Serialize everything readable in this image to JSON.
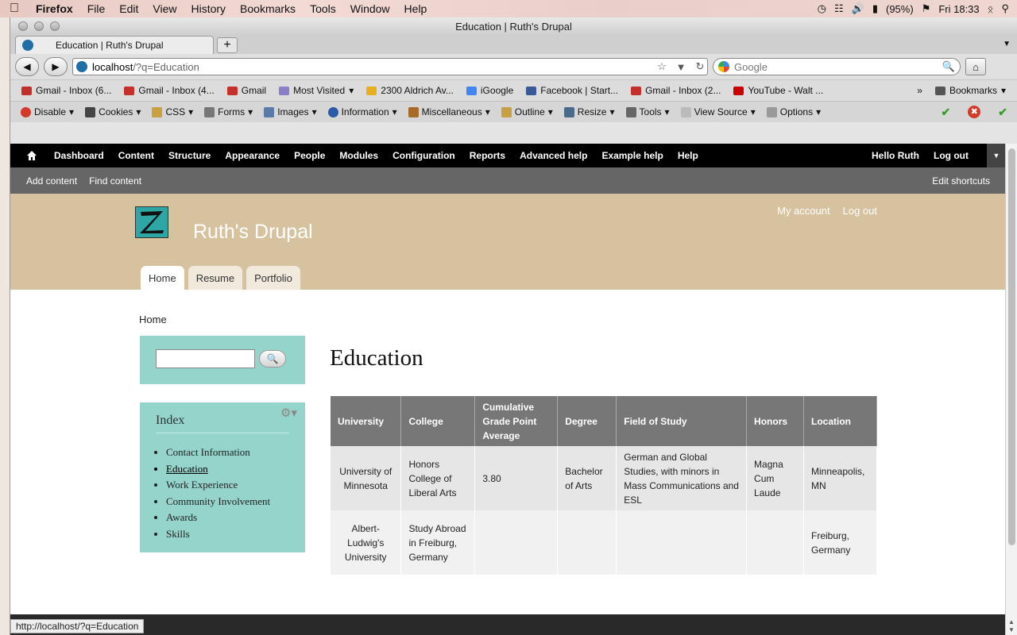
{
  "macbar": {
    "app": "Firefox",
    "menus": [
      "File",
      "Edit",
      "View",
      "History",
      "Bookmarks",
      "Tools",
      "Window",
      "Help"
    ],
    "battery": "(95%)",
    "clock": "Fri 18:33"
  },
  "window": {
    "title": "Education | Ruth's Drupal"
  },
  "tabs": [
    {
      "label": "Education | Ruth's Drupal"
    }
  ],
  "url": {
    "host": "localhost",
    "path": "/?q=Education"
  },
  "search": {
    "placeholder": "Google"
  },
  "bookmarks": {
    "items": [
      {
        "label": "Gmail - Inbox (6...",
        "color": "#c4302b"
      },
      {
        "label": "Gmail - Inbox (4...",
        "color": "#c4302b"
      },
      {
        "label": "Gmail",
        "color": "#c4302b"
      },
      {
        "label": "Most Visited",
        "color": "#8b7fc9"
      },
      {
        "label": "2300 Aldrich Av...",
        "color": "#e8b020"
      },
      {
        "label": "iGoogle",
        "color": "#4285f4"
      },
      {
        "label": "Facebook | Start...",
        "color": "#3b5998"
      },
      {
        "label": "Gmail - Inbox (2...",
        "color": "#c4302b"
      },
      {
        "label": "YouTube - Walt ...",
        "color": "#cc0000"
      }
    ],
    "overflow": "»",
    "bookmarks_label": "Bookmarks"
  },
  "devbar": {
    "items": [
      "Disable",
      "Cookies",
      "CSS",
      "Forms",
      "Images",
      "Information",
      "Miscellaneous",
      "Outline",
      "Resize",
      "Tools",
      "View Source",
      "Options"
    ]
  },
  "admin": {
    "items": [
      "Dashboard",
      "Content",
      "Structure",
      "Appearance",
      "People",
      "Modules",
      "Configuration",
      "Reports",
      "Advanced help",
      "Example help",
      "Help"
    ],
    "hello": "Hello Ruth",
    "logout": "Log out"
  },
  "shortcuts": {
    "items": [
      "Add content",
      "Find content"
    ],
    "edit": "Edit shortcuts"
  },
  "site": {
    "name": "Ruth's Drupal",
    "secondary": [
      "My account",
      "Log out"
    ],
    "tabs": [
      "Home",
      "Resume",
      "Portfolio"
    ]
  },
  "breadcrumb": "Home",
  "index": {
    "title": "Index",
    "items": [
      "Contact Information",
      "Education",
      "Work Experience",
      "Community Involvement",
      "Awards",
      "Skills"
    ]
  },
  "page": {
    "title": "Education"
  },
  "table": {
    "headers": [
      "University",
      "College",
      "Cumulative Grade Point Average",
      "Degree",
      "Field of Study",
      "Honors",
      "Location"
    ],
    "rows": [
      [
        "University of Minnesota",
        "Honors College of Liberal Arts",
        "3.80",
        "Bachelor of Arts",
        "German and Global Studies, with minors in Mass Communications and ESL",
        "Magna Cum Laude",
        "Minneapolis, MN"
      ],
      [
        "Albert-Ludwig's University",
        "Study Abroad in Freiburg, Germany",
        "",
        "",
        "",
        "",
        "Freiburg, Germany"
      ]
    ]
  },
  "status": "http://localhost/?q=Education"
}
